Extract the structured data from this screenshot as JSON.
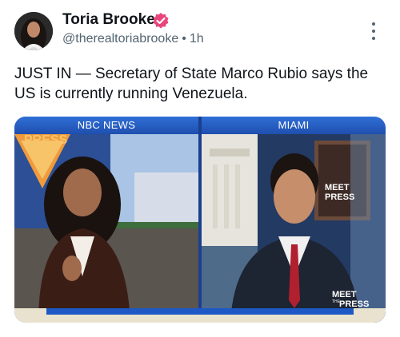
{
  "post": {
    "author_name": "Toria Brooke",
    "handle": "@therealtoriabrooke",
    "time": "1h",
    "separator": "•",
    "text": "JUST IN — Secretary of State Marco Rubio says the US is currently running Venezuela."
  },
  "media": {
    "left_banner": "NBC NEWS",
    "right_banner": "MIAMI",
    "background_logo_text": "PRESS",
    "monitor_logo_line1": "MEET",
    "monitor_logo_line2": "PRESS",
    "corner_logo_line1": "MEET",
    "corner_logo_line2": "PRESS",
    "corner_logo_small": "THE"
  },
  "icons": {
    "verified": "verified-badge-icon",
    "more": "more-options-icon"
  },
  "colors": {
    "verified_pink": "#e8457c",
    "banner_blue": "#2f6fd6",
    "text_primary": "#0f1419",
    "text_secondary": "#536471"
  }
}
